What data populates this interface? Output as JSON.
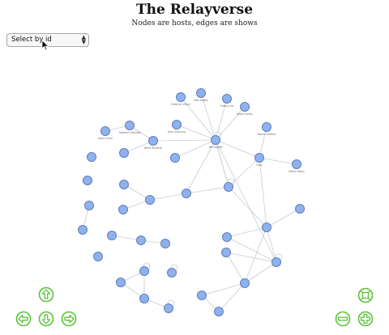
{
  "page": {
    "title": "The Relayverse",
    "subtitle": "Nodes are hosts, edges are shows"
  },
  "select": {
    "value": "Select by id"
  },
  "controls": [
    {
      "name": "pan-up-button",
      "icon": "arrow-up-icon"
    },
    {
      "name": "pan-left-button",
      "icon": "arrow-left-icon"
    },
    {
      "name": "pan-down-button",
      "icon": "arrow-down-icon"
    },
    {
      "name": "pan-right-button",
      "icon": "arrow-right-icon"
    },
    {
      "name": "fit-view-button",
      "icon": "fit-screen-icon"
    },
    {
      "name": "zoom-out-button",
      "icon": "minus-icon"
    },
    {
      "name": "zoom-in-button",
      "icon": "plus-icon"
    }
  ],
  "colors": {
    "node_fill": "#8fb1ec",
    "node_stroke": "#5f7fc0",
    "edge": "#c8ccd8",
    "control_green": "#5cc23a"
  },
  "graph": {
    "nodes": [
      {
        "id": "n1",
        "label": "Dan Frakes"
      },
      {
        "id": "n2",
        "label": "Federico Viticci"
      },
      {
        "id": "n3",
        "label": "Casey Liss"
      },
      {
        "id": "n4",
        "label": "Myke Hurley"
      },
      {
        "id": "n5",
        "label": "Stephen Hackett"
      },
      {
        "id": "n6",
        "label": "Jason Snell"
      },
      {
        "id": "n7",
        "label": "Brett Terpstra"
      },
      {
        "id": "n8",
        "label": "John Siracusa"
      },
      {
        "id": "n9",
        "label": "Marco Arment"
      },
      {
        "id": "n10",
        "label": "Jeff Gamet"
      },
      {
        "id": "n11",
        "label": "Grey"
      },
      {
        "id": "n12",
        "label": "Merlin Mann"
      }
    ]
  }
}
